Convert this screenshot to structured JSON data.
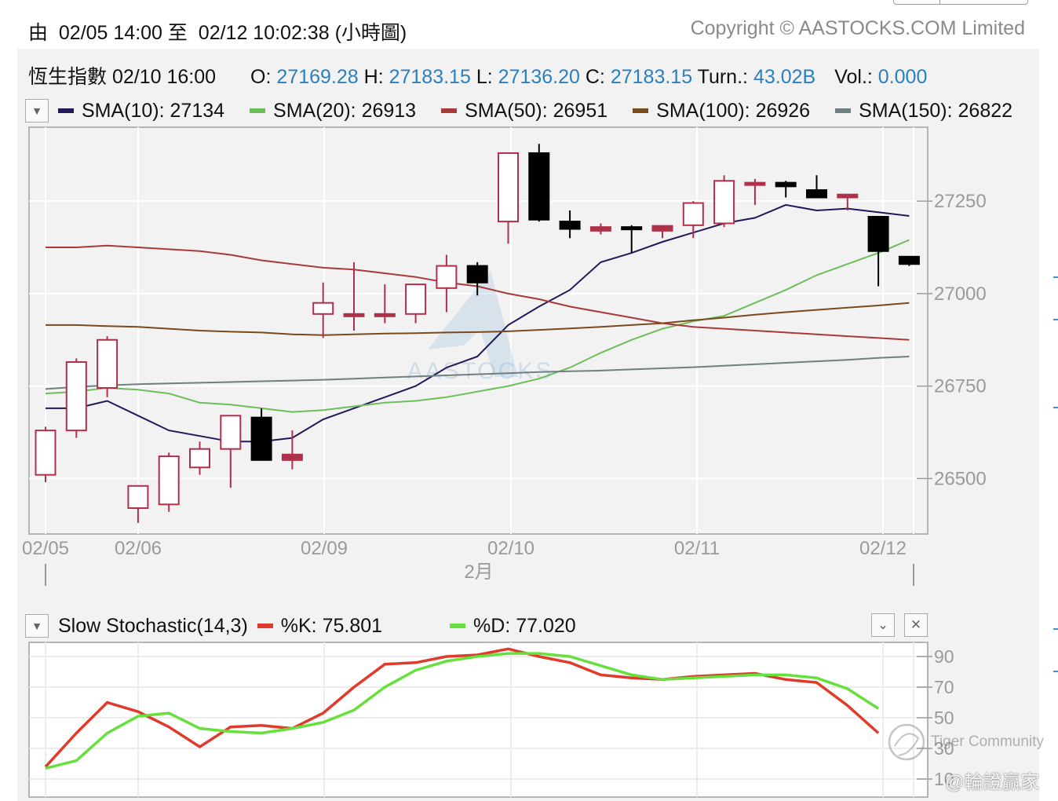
{
  "header": {
    "range_text": "由  02/05 14:00 至  02/12 10:02:38 (小時圖)",
    "copyright": "Copyright © AASTOCKS.COM Limited"
  },
  "info": {
    "name": "恆生指數",
    "datetime": "02/10 16:00",
    "o_label": "O:",
    "o_value": "27169.28",
    "h_label": "H:",
    "h_value": "27183.15",
    "l_label": "L:",
    "l_value": "27136.20",
    "c_label": "C:",
    "c_value": "27183.15",
    "turn_label": "Turn.:",
    "turn_value": "43.02B",
    "vol_label": "Vol.:",
    "vol_value": "0.000"
  },
  "sma_legend": [
    {
      "label": "SMA(10): 27134",
      "color": "#24185a"
    },
    {
      "label": "SMA(20): 26913",
      "color": "#6cbf58"
    },
    {
      "label": "SMA(50): 26951",
      "color": "#a83a3a"
    },
    {
      "label": "SMA(100): 26926",
      "color": "#7a4a1e"
    },
    {
      "label": "SMA(150): 26822",
      "color": "#6f8080"
    }
  ],
  "stoch_legend": {
    "title": "Slow Stochastic(14,3)",
    "k_label": "%K: 75.801",
    "k_color": "#e03a2a",
    "d_label": "%D: 77.020",
    "d_color": "#66e03c"
  },
  "watermarks": {
    "center": "AASTOCKS",
    "community": "Tiger Community",
    "handle": "@輪證贏家"
  },
  "colors": {
    "up": "#b0304a",
    "down": "#000000",
    "price_axis": "#9a9a9a"
  },
  "chart_data": [
    {
      "type": "candlestick",
      "ylim": [
        26350,
        27450
      ],
      "y_ticks": [
        26500,
        26750,
        27000,
        27250
      ],
      "x_tick_labels": [
        "02/05",
        "02/06",
        "02/09",
        "02/10",
        "02/11",
        "02/12"
      ],
      "month_label": "2月",
      "grid": true,
      "candles": [
        {
          "o": 26510,
          "h": 26640,
          "l": 26490,
          "c": 26630
        },
        {
          "o": 26630,
          "h": 26825,
          "l": 26610,
          "c": 26815
        },
        {
          "o": 26745,
          "h": 26885,
          "l": 26720,
          "c": 26875
        },
        {
          "o": 26420,
          "h": 26470,
          "l": 26380,
          "c": 26480
        },
        {
          "o": 26430,
          "h": 26570,
          "l": 26410,
          "c": 26560
        },
        {
          "o": 26530,
          "h": 26600,
          "l": 26510,
          "c": 26580
        },
        {
          "o": 26580,
          "h": 26670,
          "l": 26475,
          "c": 26670
        },
        {
          "o": 26665,
          "h": 26690,
          "l": 26550,
          "c": 26550
        },
        {
          "o": 26550,
          "h": 26630,
          "l": 26525,
          "c": 26565
        },
        {
          "o": 26945,
          "h": 27030,
          "l": 26880,
          "c": 26975
        },
        {
          "o": 26945,
          "h": 27085,
          "l": 26900,
          "c": 26945
        },
        {
          "o": 26945,
          "h": 27025,
          "l": 26920,
          "c": 26945
        },
        {
          "o": 26945,
          "h": 27025,
          "l": 26920,
          "c": 27025
        },
        {
          "o": 27015,
          "h": 27105,
          "l": 26950,
          "c": 27075
        },
        {
          "o": 27075,
          "h": 27085,
          "l": 26995,
          "c": 27030
        },
        {
          "o": 27195,
          "h": 27380,
          "l": 27135,
          "c": 27380
        },
        {
          "o": 27380,
          "h": 27405,
          "l": 27195,
          "c": 27200
        },
        {
          "o": 27195,
          "h": 27225,
          "l": 27150,
          "c": 27175
        },
        {
          "o": 27170,
          "h": 27190,
          "l": 27160,
          "c": 27180
        },
        {
          "o": 27180,
          "h": 27185,
          "l": 27110,
          "c": 27175
        },
        {
          "o": 27170,
          "h": 27185,
          "l": 27150,
          "c": 27183.15
        },
        {
          "o": 27185,
          "h": 27250,
          "l": 27150,
          "c": 27245
        },
        {
          "o": 27190,
          "h": 27320,
          "l": 27180,
          "c": 27305
        },
        {
          "o": 27300,
          "h": 27310,
          "l": 27240,
          "c": 27300
        },
        {
          "o": 27300,
          "h": 27305,
          "l": 27260,
          "c": 27290
        },
        {
          "o": 27280,
          "h": 27320,
          "l": 27260,
          "c": 27260
        },
        {
          "o": 27260,
          "h": 27270,
          "l": 27225,
          "c": 27268
        },
        {
          "o": 27208,
          "h": 27210,
          "l": 27020,
          "c": 27115
        },
        {
          "o": 27100,
          "h": 27100,
          "l": 27075,
          "c": 27080
        }
      ],
      "series": [
        {
          "name": "SMA(10)",
          "color": "#24185a",
          "values": [
            26690,
            26690,
            26710,
            26670,
            26630,
            26615,
            26600,
            26600,
            26610,
            26660,
            26690,
            26720,
            26750,
            26800,
            26830,
            26915,
            26965,
            27010,
            27085,
            27110,
            27140,
            27165,
            27190,
            27205,
            27240,
            27225,
            27230,
            27220,
            27210
          ]
        },
        {
          "name": "SMA(20)",
          "color": "#6cbf58",
          "values": [
            26730,
            26735,
            26745,
            26740,
            26730,
            26705,
            26700,
            26690,
            26680,
            26685,
            26695,
            26705,
            26710,
            26720,
            26735,
            26750,
            26770,
            26800,
            26840,
            26875,
            26905,
            26925,
            26940,
            26975,
            27010,
            27050,
            27080,
            27110,
            27145
          ]
        },
        {
          "name": "SMA(50)",
          "color": "#a83a3a",
          "values": [
            27125,
            27125,
            27130,
            27125,
            27120,
            27115,
            27105,
            27090,
            27080,
            27070,
            27065,
            27055,
            27045,
            27030,
            27020,
            27000,
            26985,
            26965,
            26950,
            26935,
            26920,
            26910,
            26905,
            26900,
            26895,
            26890,
            26885,
            26880,
            26875
          ]
        },
        {
          "name": "SMA(100)",
          "color": "#7a4a1e",
          "values": [
            26915,
            26915,
            26912,
            26910,
            26905,
            26900,
            26897,
            26895,
            26890,
            26888,
            26890,
            26892,
            26893,
            26895,
            26896,
            26898,
            26902,
            26906,
            26910,
            26915,
            26920,
            26928,
            26935,
            26943,
            26950,
            26956,
            26962,
            26968,
            26975
          ]
        },
        {
          "name": "SMA(150)",
          "color": "#6f8080",
          "values": [
            26742,
            26748,
            26752,
            26755,
            26757,
            26759,
            26761,
            26763,
            26765,
            26767,
            26770,
            26773,
            26776,
            26779,
            26782,
            26785,
            26788,
            26790,
            26792,
            26795,
            26798,
            26801,
            26805,
            26809,
            26813,
            26817,
            26821,
            26826,
            26830
          ]
        }
      ]
    },
    {
      "type": "line",
      "title": "Slow Stochastic(14,3)",
      "ylim": [
        0,
        100
      ],
      "y_ticks": [
        10,
        30,
        50,
        70,
        90
      ],
      "series": [
        {
          "name": "%K",
          "color": "#e03a2a",
          "values": [
            18,
            40,
            60,
            54,
            44,
            31,
            44,
            45,
            43,
            53,
            70,
            85,
            86,
            90,
            91,
            95,
            90,
            86,
            78,
            76,
            75,
            77,
            78,
            79,
            75,
            73,
            58,
            40
          ]
        },
        {
          "name": "%D",
          "color": "#66e03c",
          "values": [
            17,
            22,
            40,
            51,
            53,
            43,
            41,
            40,
            43,
            47,
            55,
            70,
            81,
            87,
            90,
            92,
            92,
            90,
            84,
            78,
            75,
            76,
            77,
            78,
            78,
            76,
            69,
            56
          ]
        }
      ]
    }
  ]
}
